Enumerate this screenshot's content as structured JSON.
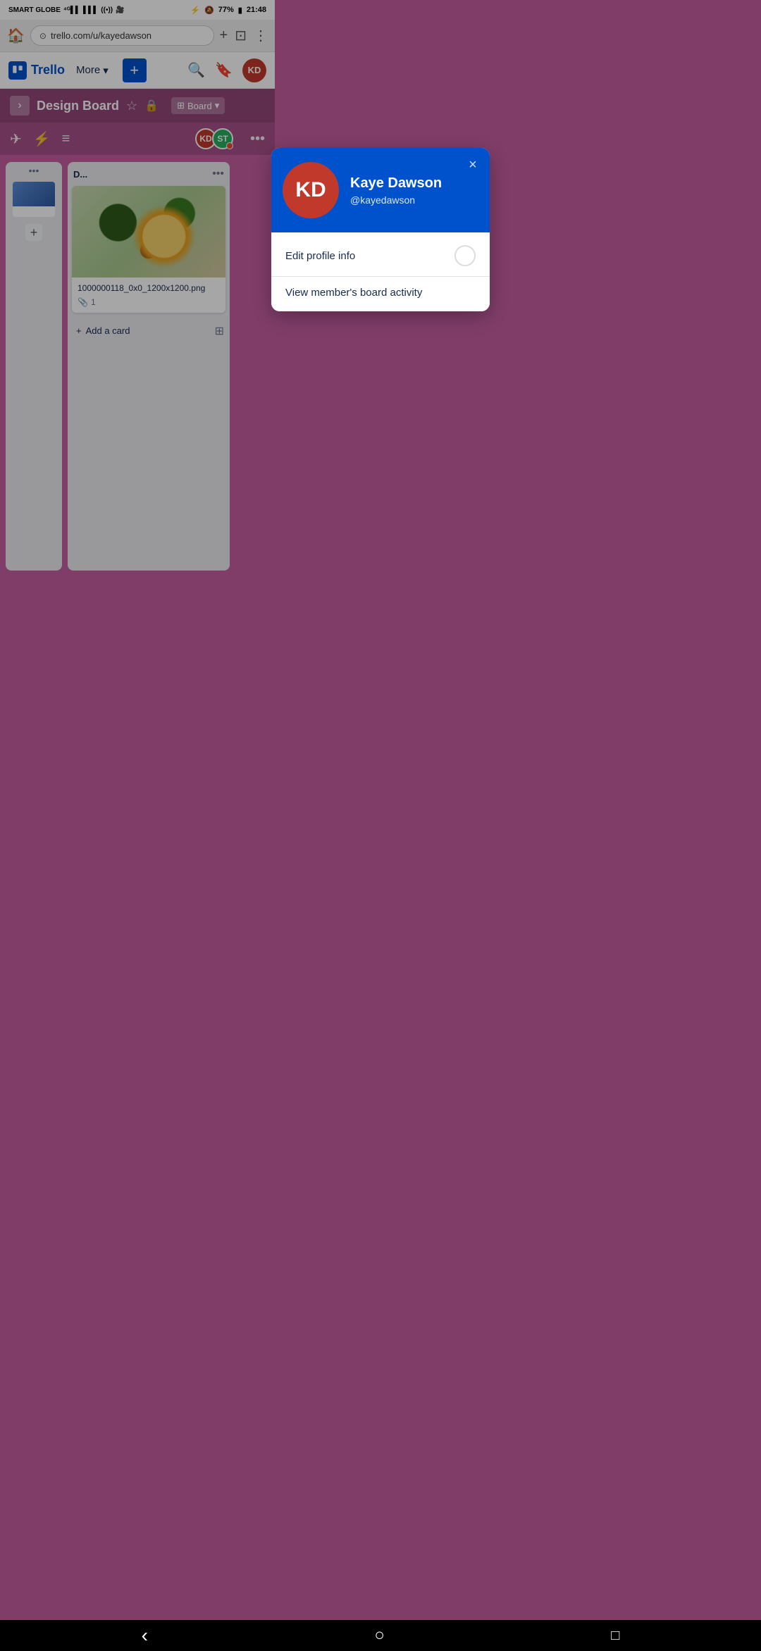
{
  "statusBar": {
    "carrier": "SMART GLOBE",
    "signal": "4G",
    "time": "21:48",
    "battery": "77%",
    "bluetooth": "BT",
    "silent": "🔕"
  },
  "browserBar": {
    "url": "trello.com/u/kayedawson",
    "homeIcon": "🏠",
    "addTabIcon": "+",
    "tabsIcon": "⊡",
    "menuIcon": "⋮"
  },
  "trelloNav": {
    "logoText": "Trello",
    "moreLabel": "More",
    "addLabel": "+",
    "searchIcon": "search",
    "notifyIcon": "bookmark",
    "avatarInitials": "KD"
  },
  "boardHeader": {
    "collapseIcon": "›",
    "title": "Design Board",
    "starIcon": "☆",
    "lockIcon": "🔒",
    "viewLabel": "Board",
    "viewDropIcon": "▾"
  },
  "boardToolbar": {
    "planeIcon": "✈",
    "boltIcon": "⚡",
    "filterIcon": "≡",
    "avatarKD": "KD",
    "avatarST": "ST",
    "moreIcon": "•••"
  },
  "lists": [
    {
      "id": "narrow-list",
      "narrow": true,
      "cards": [
        {
          "hasImage": true,
          "imageColor": "#5b8dd9"
        }
      ]
    },
    {
      "id": "main-list",
      "narrow": false,
      "title": "D...",
      "menuIcon": "•••",
      "cards": [
        {
          "hasImage": true,
          "title": "1000000118_0x0_1200x1200.png",
          "attachments": "1"
        }
      ],
      "addCardLabel": "Add a card",
      "addCardIcon": "+"
    }
  ],
  "profilePopup": {
    "avatarInitials": "KD",
    "avatarColor": "#c0392b",
    "headerBgColor": "#0052cc",
    "name": "Kaye Dawson",
    "username": "@kayedawson",
    "closeIcon": "×",
    "menuItems": [
      {
        "id": "edit-profile",
        "label": "Edit profile info",
        "hasToggle": true
      },
      {
        "id": "view-activity",
        "label": "View member's board activity",
        "hasToggle": false
      }
    ]
  },
  "bottomNav": {
    "backIcon": "‹",
    "homeIcon": "○",
    "squareIcon": "□"
  }
}
